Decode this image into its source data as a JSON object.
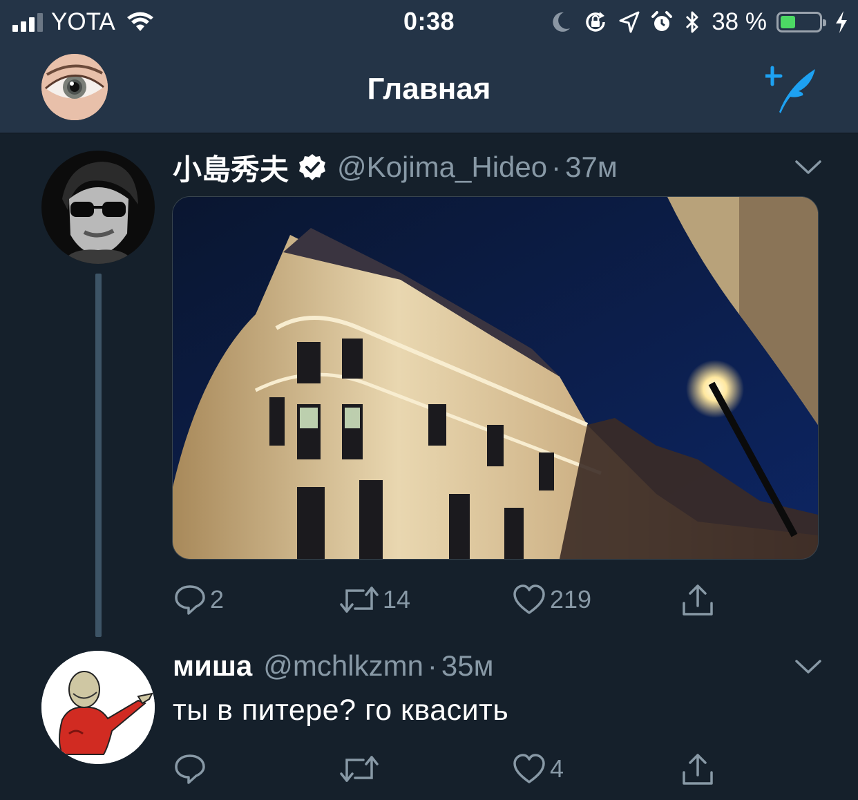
{
  "status_bar": {
    "carrier": "YOTA",
    "time": "0:38",
    "battery_percent": "38 %",
    "battery_level": 0.38,
    "icons": [
      "signal-icon",
      "wifi-icon",
      "moon-icon",
      "rotation-lock-icon",
      "location-icon",
      "alarm-icon",
      "bluetooth-icon",
      "battery-icon",
      "charging-icon"
    ]
  },
  "nav": {
    "title": "Главная",
    "compose_icon": "compose-tweet-icon"
  },
  "tweets": [
    {
      "display_name": "小島秀夫",
      "verified": true,
      "handle": "@Kojima_Hideo",
      "separator": "·",
      "time": "37м",
      "media": "photo of illuminated corner building at night with street lamp",
      "actions": {
        "reply_count": "2",
        "retweet_count": "14",
        "like_count": "219"
      }
    },
    {
      "display_name": "миша",
      "handle": "@mchlkzmn",
      "separator": "·",
      "time": "35м",
      "text": "ты в питере? го квасить",
      "actions": {
        "reply_count": "",
        "retweet_count": "",
        "like_count": "4"
      }
    }
  ],
  "colors": {
    "background": "#15202b",
    "header": "#243447",
    "accent": "#1da1f2",
    "muted": "#8899a6",
    "battery": "#4cd964"
  }
}
